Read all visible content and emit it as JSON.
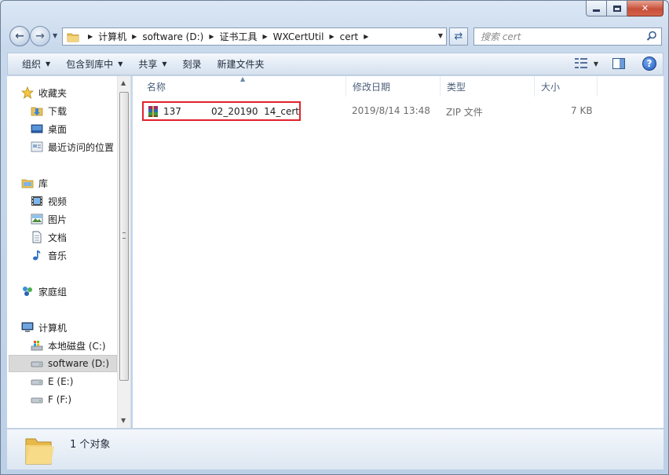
{
  "window": {
    "caption": {
      "minimize": "",
      "maximize": "",
      "close": "✕"
    }
  },
  "address": {
    "crumbs": [
      "计算机",
      "software (D:)",
      "证书工具",
      "WXCertUtil",
      "cert"
    ],
    "search_placeholder": "搜索 cert"
  },
  "toolbar": {
    "organize": "组织",
    "include_in_library": "包含到库中",
    "share": "共享",
    "burn": "刻录",
    "new_folder": "新建文件夹"
  },
  "sidebar": {
    "favorites": {
      "label": "收藏夹",
      "items": [
        "下载",
        "桌面",
        "最近访问的位置"
      ]
    },
    "libraries": {
      "label": "库",
      "items": [
        "视频",
        "图片",
        "文档",
        "音乐"
      ]
    },
    "homegroup": {
      "label": "家庭组"
    },
    "computer": {
      "label": "计算机",
      "items": [
        "本地磁盘 (C:)",
        "software (D:)",
        "E (E:)",
        "F (F:)"
      ]
    },
    "selected": "software (D:)"
  },
  "columns": {
    "name": "名称",
    "modified": "修改日期",
    "type": "类型",
    "size": "大小"
  },
  "files": [
    {
      "name": "137          02_20190  14_cert",
      "modified": "2019/8/14 13:48",
      "type": "ZIP 文件",
      "size": "7 KB"
    }
  ],
  "status": {
    "count_text": "1 个对象"
  },
  "colors": {
    "highlight_border": "#e0232a",
    "window_frame": "#bcd0e8"
  }
}
